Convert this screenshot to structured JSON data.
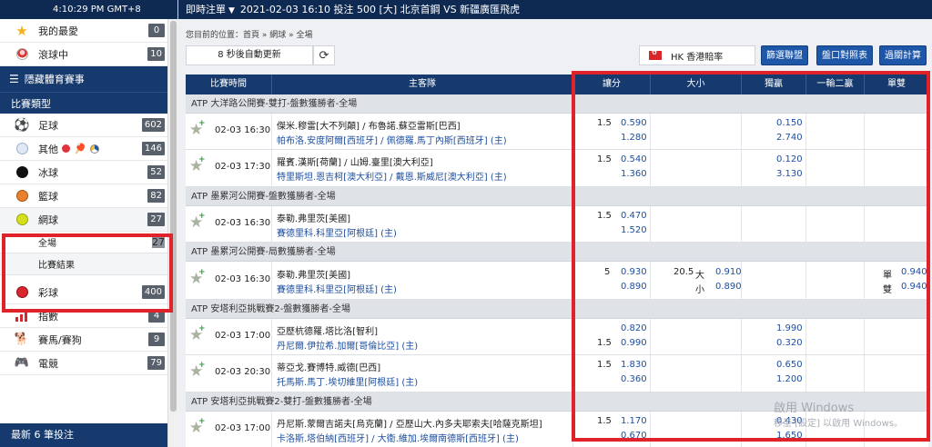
{
  "clock": "4:10:29 PM GMT+8",
  "topbar": {
    "live_label": "即時注單",
    "info": "2021-02-03 16:10 投注 500 [大] 北京首鋼 VS 新疆廣匯飛虎"
  },
  "sidebar": {
    "favorites": {
      "label": "我的最愛",
      "count": "0"
    },
    "live": {
      "label": "滾球中",
      "count": "10"
    },
    "hide_events": "隱藏體育賽事",
    "sport_type": "比賽類型",
    "sports": [
      {
        "label": "足球",
        "count": "602"
      },
      {
        "label": "其他",
        "count": "146"
      },
      {
        "label": "冰球",
        "count": "52"
      },
      {
        "label": "籃球",
        "count": "82"
      },
      {
        "label": "網球",
        "count": "27"
      }
    ],
    "tennis_sub": [
      {
        "label": "全場",
        "count": "27"
      },
      {
        "label": "比賽結果",
        "count": ""
      }
    ],
    "more_sports": [
      {
        "label": "彩球",
        "count": "400"
      },
      {
        "label": "指數",
        "count": "4"
      },
      {
        "label": "賽馬/賽狗",
        "count": "9"
      },
      {
        "label": "電競",
        "count": "79"
      }
    ],
    "latest_bets": "最新 6 筆投注"
  },
  "main": {
    "breadcrumb": "您目前的位置：首頁 » 網球 » 全場",
    "auto_refresh": "8 秒後自動更新",
    "odds_type": "HK  香港賠率",
    "buttons": {
      "filter_league": "篩選聯盟",
      "odds_table": "盤口對照表",
      "parlay": "過關計算"
    }
  },
  "table": {
    "headers": [
      "比賽時間",
      "主客隊",
      "讓分",
      "大小",
      "獨贏",
      "一輸二贏",
      "單雙"
    ],
    "leagues": [
      "ATP 大洋路公開賽-雙打-盤數獲勝者-全場",
      "ATP 墨累河公開賽-盤數獲勝者-全場",
      "ATP 墨累河公開賽-局數獲勝者-全場",
      "ATP 安塔利亞挑戰賽2-盤數獲勝者-全場",
      "ATP 安塔利亞挑戰賽2-雙打-盤數獲勝者-全場"
    ],
    "matches": [
      {
        "time": "02-03 16:30",
        "home": "傑米.穆雷[大不列顛] / 布魯諾.蘇亞雷斯[巴西]",
        "away": "帕布洛.安度阿爾[西班牙] / 佩德羅.馬丁內斯[西班牙] (主)",
        "hcap_line": "1.5",
        "hcap_home": "0.590",
        "hcap_away": "1.280",
        "ml_home": "0.150",
        "ml_away": "2.740"
      },
      {
        "time": "02-03 17:30",
        "home": "羅賓.漢斯[荷蘭] / 山姆.臺里[澳大利亞]",
        "away": "特里斯坦.恩吉柯[澳大利亞] / 戴恩.斯威尼[澳大利亞] (主)",
        "hcap_line": "1.5",
        "hcap_home": "0.540",
        "hcap_away": "1.360",
        "ml_home": "0.120",
        "ml_away": "3.130"
      },
      {
        "time": "02-03 16:30",
        "home": "泰勒.弗里茨[美國]",
        "away": "賽德里科.科里亞[阿根廷] (主)",
        "hcap_line": "1.5",
        "hcap_home": "0.470",
        "hcap_away": "1.520"
      },
      {
        "time": "02-03 16:30",
        "home": "泰勒.弗里茨[美國]",
        "away": "賽德里科.科里亞[阿根廷] (主)",
        "hcap_line": "5",
        "hcap_home": "0.930",
        "hcap_away": "0.890",
        "ou_line": "20.5",
        "ou_over": "大",
        "ou_under": "小",
        "ou_over_odd": "0.910",
        "ou_under_odd": "0.890",
        "oe_odd": "單",
        "oe_even": "雙",
        "oe_odd_val": "0.940",
        "oe_even_val": "0.940"
      },
      {
        "time": "02-03 17:00",
        "home": "亞歷杭德羅.塔比洛[智利]",
        "away": "丹尼爾.伊拉希.加爾[哥倫比亞] (主)",
        "hcap_line": "1.5",
        "hcap_home": "0.820",
        "hcap_away": "0.990",
        "ml_home": "1.990",
        "ml_away": "0.320"
      },
      {
        "time": "02-03 20:30",
        "home": "蒂亞戈.賽博特.威德[巴西]",
        "away": "托馬斯.馬丁.埃切維里[阿根廷] (主)",
        "hcap_line": "1.5",
        "hcap_home": "1.830",
        "hcap_away": "0.360",
        "ml_home": "0.650",
        "ml_away": "1.200"
      },
      {
        "time": "02-03 17:00",
        "home": "丹尼斯.蒙爾吉諾夫[烏克蘭] / 亞歷山大.內多夫耶索夫[哈薩克斯坦]",
        "away": "卡洛斯.塔伯納[西班牙] / 大衛.維加.埃爾南德斯[西班牙] (主)",
        "hcap_line": "1.5",
        "hcap_home": "1.170",
        "hcap_away": "0.670",
        "ml_home": "0.430",
        "ml_away": "1.650"
      }
    ]
  },
  "watermark": {
    "line1": "啟用 Windows",
    "line2": "移至 [設定] 以啟用 Windows。"
  },
  "colors": {
    "navy": "#0f2a52",
    "header_blue": "#163a6e",
    "button_blue": "#1e56a8",
    "odds_blue": "#1e4fa0",
    "highlight_red": "#e0232b"
  }
}
